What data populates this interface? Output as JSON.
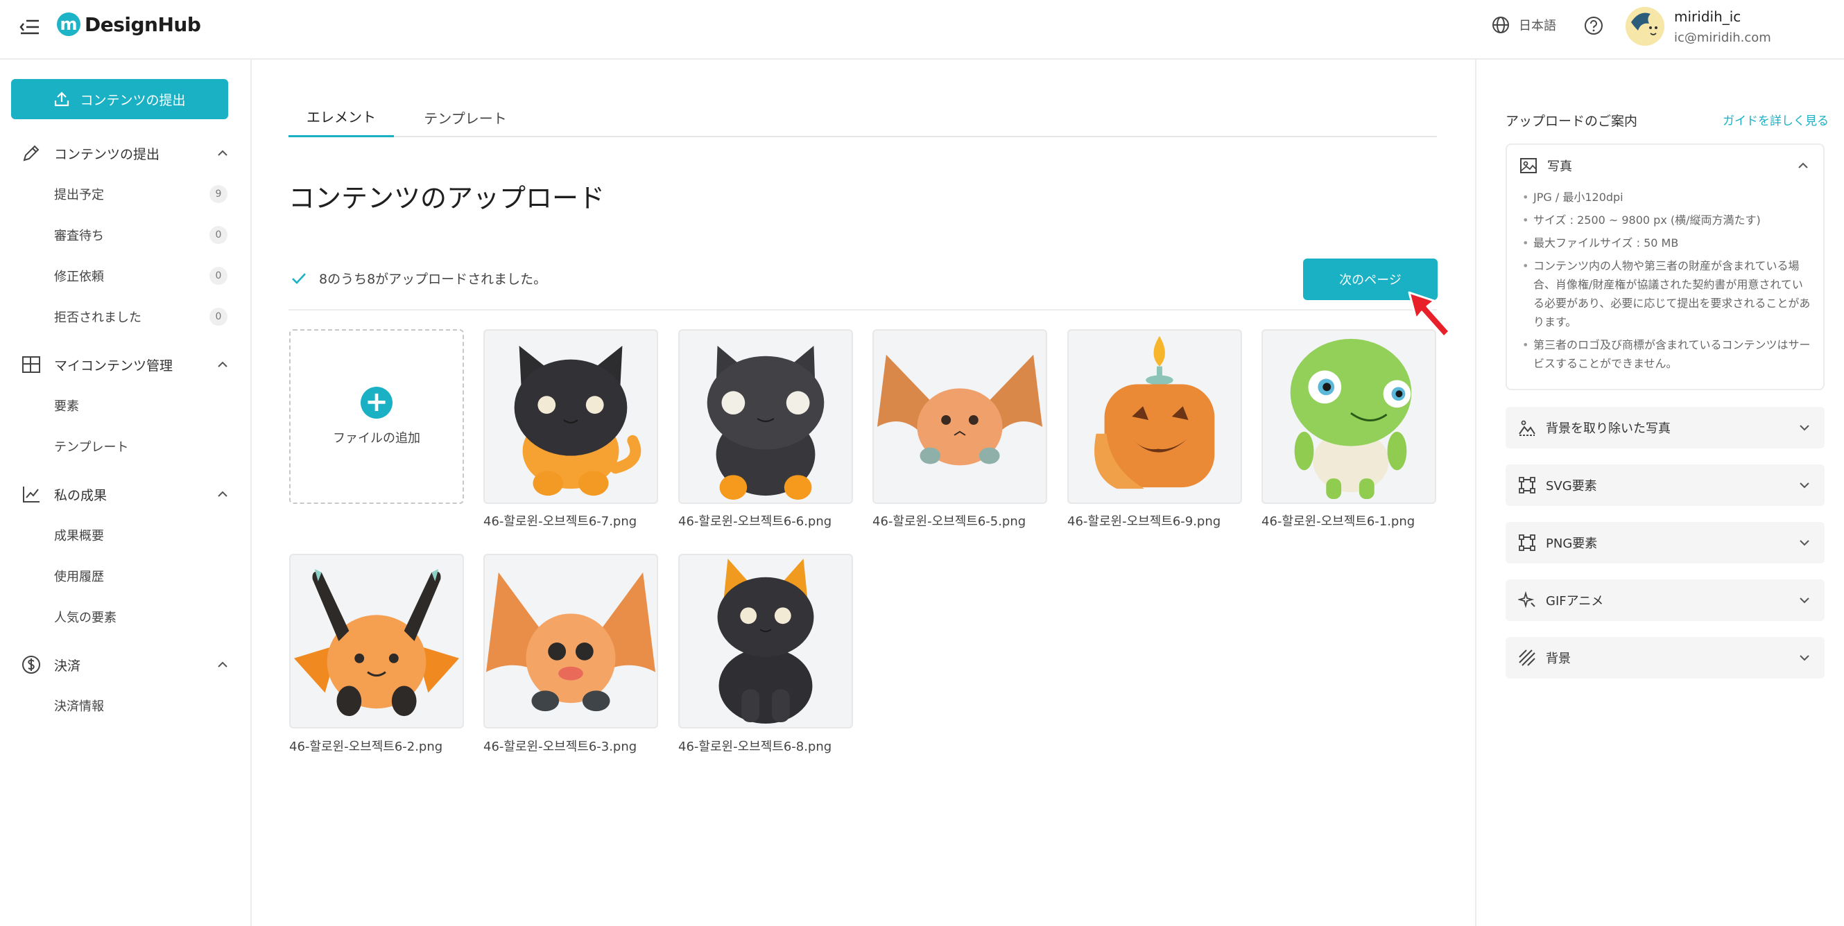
{
  "header": {
    "logo_mark": "m",
    "logo_text": "DesignHub",
    "language": "日本語",
    "user_name": "miridih_ic",
    "user_email": "ic@miridih.com"
  },
  "sidebar": {
    "submit_button": "コンテンツの提出",
    "sections": [
      {
        "label": "コンテンツの提出",
        "icon": "pencil-icon",
        "items": [
          {
            "label": "提出予定",
            "count": "9"
          },
          {
            "label": "審査待ち",
            "count": "0"
          },
          {
            "label": "修正依頼",
            "count": "0"
          },
          {
            "label": "拒否されました",
            "count": "0"
          }
        ]
      },
      {
        "label": "マイコンテンツ管理",
        "icon": "layout-grid-icon",
        "items": [
          {
            "label": "要素"
          },
          {
            "label": "テンプレート"
          }
        ]
      },
      {
        "label": "私の成果",
        "icon": "chart-line-icon",
        "items": [
          {
            "label": "成果概要"
          },
          {
            "label": "使用履歴"
          },
          {
            "label": "人気の要素"
          }
        ]
      },
      {
        "label": "決済",
        "icon": "dollar-circle-icon",
        "items": [
          {
            "label": "決済情報"
          }
        ]
      }
    ]
  },
  "main": {
    "tabs": [
      {
        "label": "エレメント",
        "active": true
      },
      {
        "label": "テンプレート",
        "active": false
      }
    ],
    "title": "コンテンツのアップロード",
    "status": "8のうち8がアップロードされました。",
    "next_button": "次のページ",
    "add_file": "ファイルの追加",
    "files": [
      {
        "name": "46-할로윈-오브젝트6-7.png",
        "kind": "cat-orange"
      },
      {
        "name": "46-할로윈-오브젝트6-6.png",
        "kind": "cat-black"
      },
      {
        "name": "46-할로윈-오브젝트6-5.png",
        "kind": "bat-small"
      },
      {
        "name": "46-할로윈-오브젝트6-9.png",
        "kind": "pumpkin-candle"
      },
      {
        "name": "46-할로윈-오브젝트6-1.png",
        "kind": "alien"
      },
      {
        "name": "46-할로윈-오브젝트6-2.png",
        "kind": "bat-ears"
      },
      {
        "name": "46-할로윈-오브젝트6-3.png",
        "kind": "bat-big"
      },
      {
        "name": "46-할로윈-오브젝트6-8.png",
        "kind": "cat-black-sitting"
      }
    ]
  },
  "guide": {
    "title": "アップロードのご案内",
    "link": "ガイドを詳しく見る",
    "photo": {
      "label": "写真",
      "rules": [
        "JPG / 最小120dpi",
        "サイズ : 2500 ~ 9800 px (横/縦両方満たす)",
        "最大ファイルサイズ : 50 MB",
        "コンテンツ内の人物や第三者の財産が含まれている場合、肖像権/財産権が協議された契約書が用意されている必要があり、必要に応じて提出を要求されることがあります。",
        "第三者のロゴ及び商標が含まれているコンテンツはサービスすることができません。"
      ]
    },
    "accordions": [
      {
        "label": "背景を取り除いた写真",
        "icon": "photo-cutout-icon"
      },
      {
        "label": "SVG要素",
        "icon": "vector-frame-icon"
      },
      {
        "label": "PNG要素",
        "icon": "vector-frame-icon"
      },
      {
        "label": "GIFアニメ",
        "icon": "sparkle-icon"
      },
      {
        "label": "背景",
        "icon": "stripes-icon"
      }
    ]
  },
  "colors": {
    "accent": "#1ab1c4",
    "cursor": "#e8202a"
  }
}
